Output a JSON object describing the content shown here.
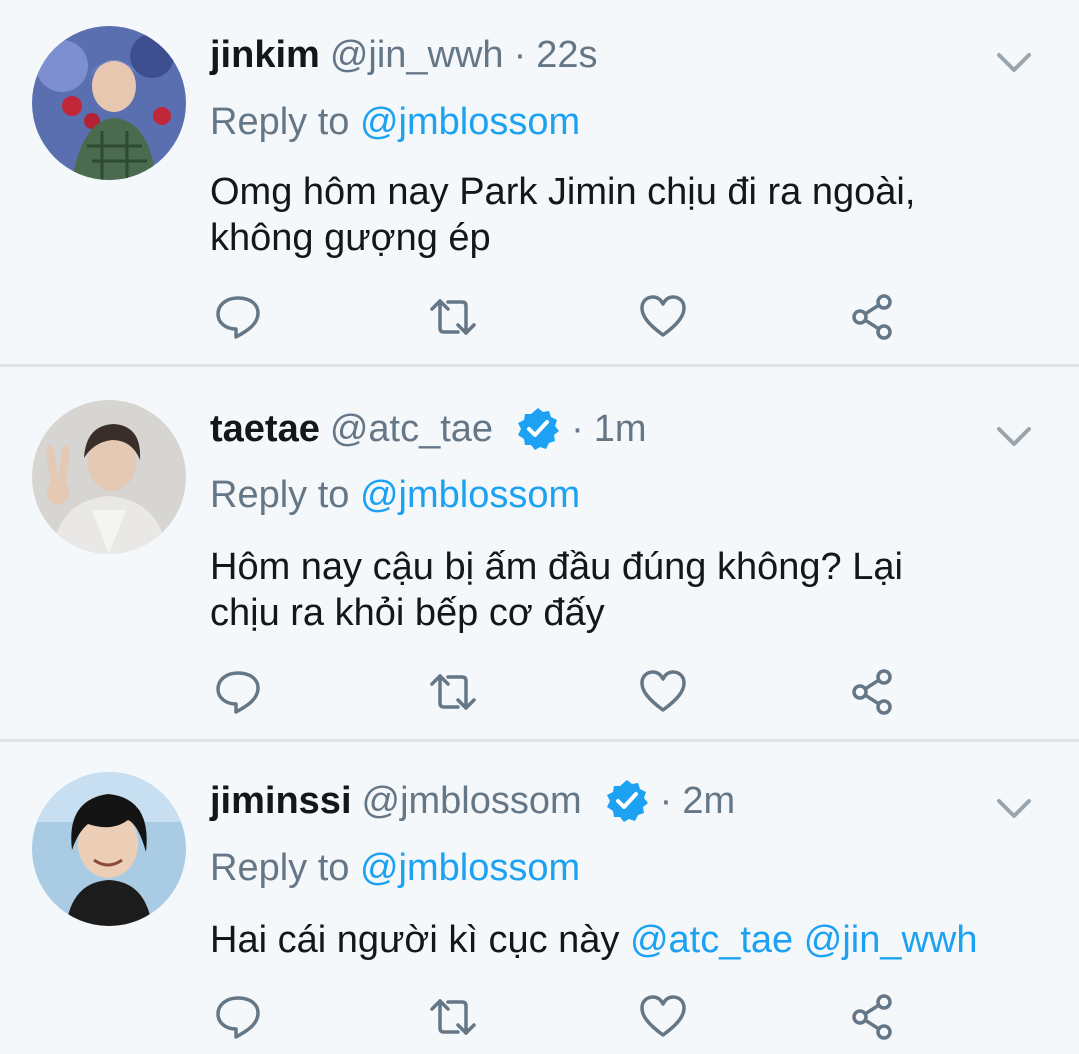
{
  "tweets": [
    {
      "name": "jinkim",
      "handle": "@jin_wwh",
      "separator": "·",
      "time": "22s",
      "verified": false,
      "reply_prefix": "Reply to",
      "reply_to": "@jmblossom",
      "text_lines": [
        "Omg hôm nay Park Jimin chịu đi ra ngoài,",
        "không gượng ép"
      ]
    },
    {
      "name": "taetae",
      "handle": "@atc_tae",
      "separator": "·",
      "time": "1m",
      "verified": true,
      "reply_prefix": "Reply to",
      "reply_to": "@jmblossom",
      "text_lines": [
        "Hôm nay cậu bị ấm đầu đúng không? Lại",
        "chịu ra khỏi bếp cơ đấy"
      ]
    },
    {
      "name": "jiminssi",
      "handle": "@jmblossom",
      "separator": "·",
      "time": "2m",
      "verified": true,
      "reply_prefix": "Reply to",
      "reply_to": "@jmblossom",
      "text_plain": "Hai cái người kì cục này ",
      "text_mention_1": "@atc_tae",
      "text_mention_2": "@jin_wwh"
    }
  ],
  "icons": {
    "reply": "reply-icon",
    "retweet": "retweet-icon",
    "like": "heart-icon",
    "share": "share-icon",
    "more": "chevron-down-icon",
    "verified": "verified-badge-icon"
  },
  "colors": {
    "background": "#f5f8fa",
    "link": "#1da1f2",
    "secondary_text": "#657786",
    "icon": "#657786",
    "divider": "#dfe4e8"
  }
}
